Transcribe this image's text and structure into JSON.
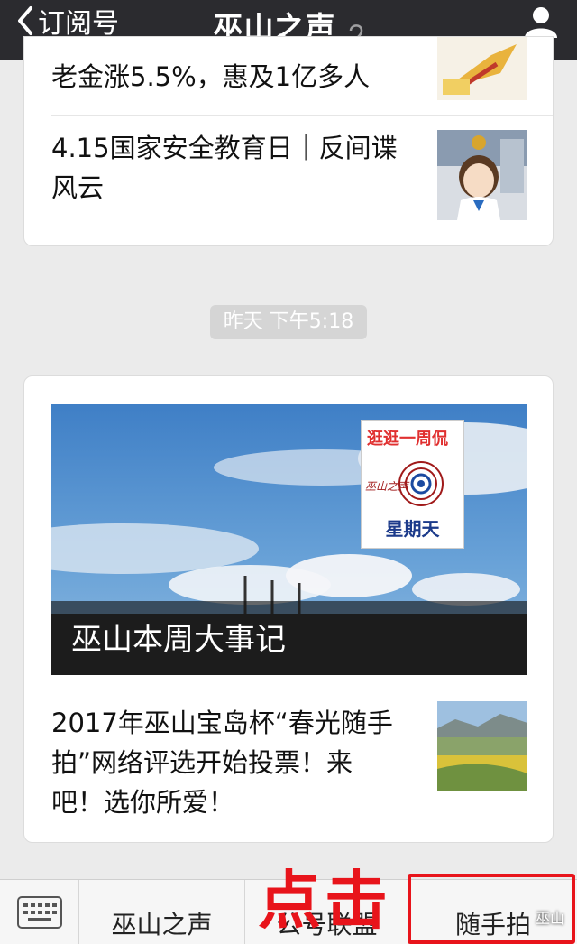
{
  "topbar": {
    "back_label": "订阅号",
    "title": "巫山之声"
  },
  "feed": {
    "card1": {
      "items": [
        {
          "title": "老金涨5.5%，惠及1亿多人"
        },
        {
          "title": "4.15国家安全教育日｜反间谍风云"
        }
      ]
    },
    "timestamp": "昨天 下午5:18",
    "card2": {
      "hero_title": "巫山本周大事记",
      "badge_top": "逛逛一周侃",
      "badge_logo": "巫山之声",
      "badge_bottom": "星期天",
      "items": [
        {
          "title": "2017年巫山宝岛杯“春光随手拍”网络评选开始投票！来吧！选你所爱！"
        }
      ]
    }
  },
  "bottom_menu": {
    "items": [
      {
        "label": "巫山之声"
      },
      {
        "label": "公号联盟"
      },
      {
        "label": "随手拍"
      }
    ]
  },
  "annotation": {
    "text": "点击",
    "color": "#e8141b"
  },
  "watermark": "巫山",
  "colors": {
    "topbar": "#2b2b2f",
    "background": "#ebebeb",
    "highlight": "#e8141b"
  }
}
